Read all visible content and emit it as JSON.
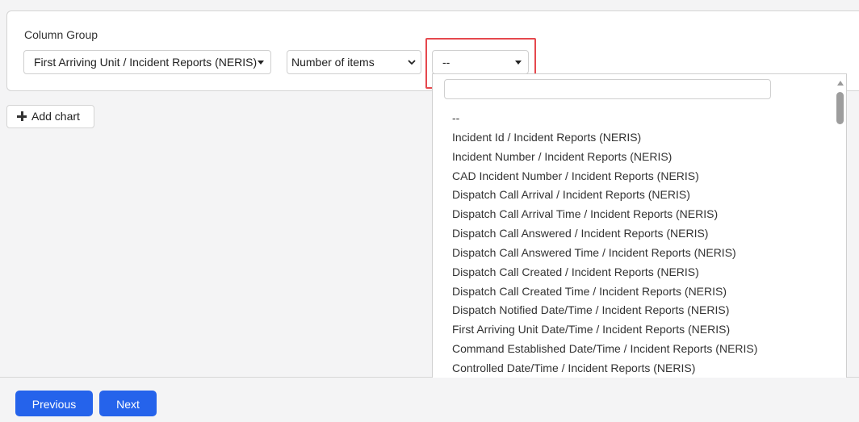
{
  "column_group": {
    "label": "Column Group",
    "group_select_value": "First Arriving Unit / Incident Reports (NERIS)",
    "aggregate_select_value": "Number of items",
    "column_select_value": "--"
  },
  "add_chart_label": "Add chart",
  "dropdown": {
    "search_value": "",
    "options": [
      "--",
      "Incident Id / Incident Reports (NERIS)",
      "Incident Number / Incident Reports (NERIS)",
      "CAD Incident Number / Incident Reports (NERIS)",
      "Dispatch Call Arrival / Incident Reports (NERIS)",
      "Dispatch Call Arrival Time / Incident Reports (NERIS)",
      "Dispatch Call Answered / Incident Reports (NERIS)",
      "Dispatch Call Answered Time / Incident Reports (NERIS)",
      "Dispatch Call Created / Incident Reports (NERIS)",
      "Dispatch Call Created Time / Incident Reports (NERIS)",
      "Dispatch Notified Date/Time / Incident Reports (NERIS)",
      "First Arriving Unit Date/Time / Incident Reports (NERIS)",
      "Command Established Date/Time / Incident Reports (NERIS)",
      "Controlled Date/Time / Incident Reports (NERIS)"
    ]
  },
  "footer": {
    "previous_label": "Previous",
    "next_label": "Next"
  },
  "colors": {
    "primary": "#2563eb",
    "highlight": "#e5484d"
  }
}
